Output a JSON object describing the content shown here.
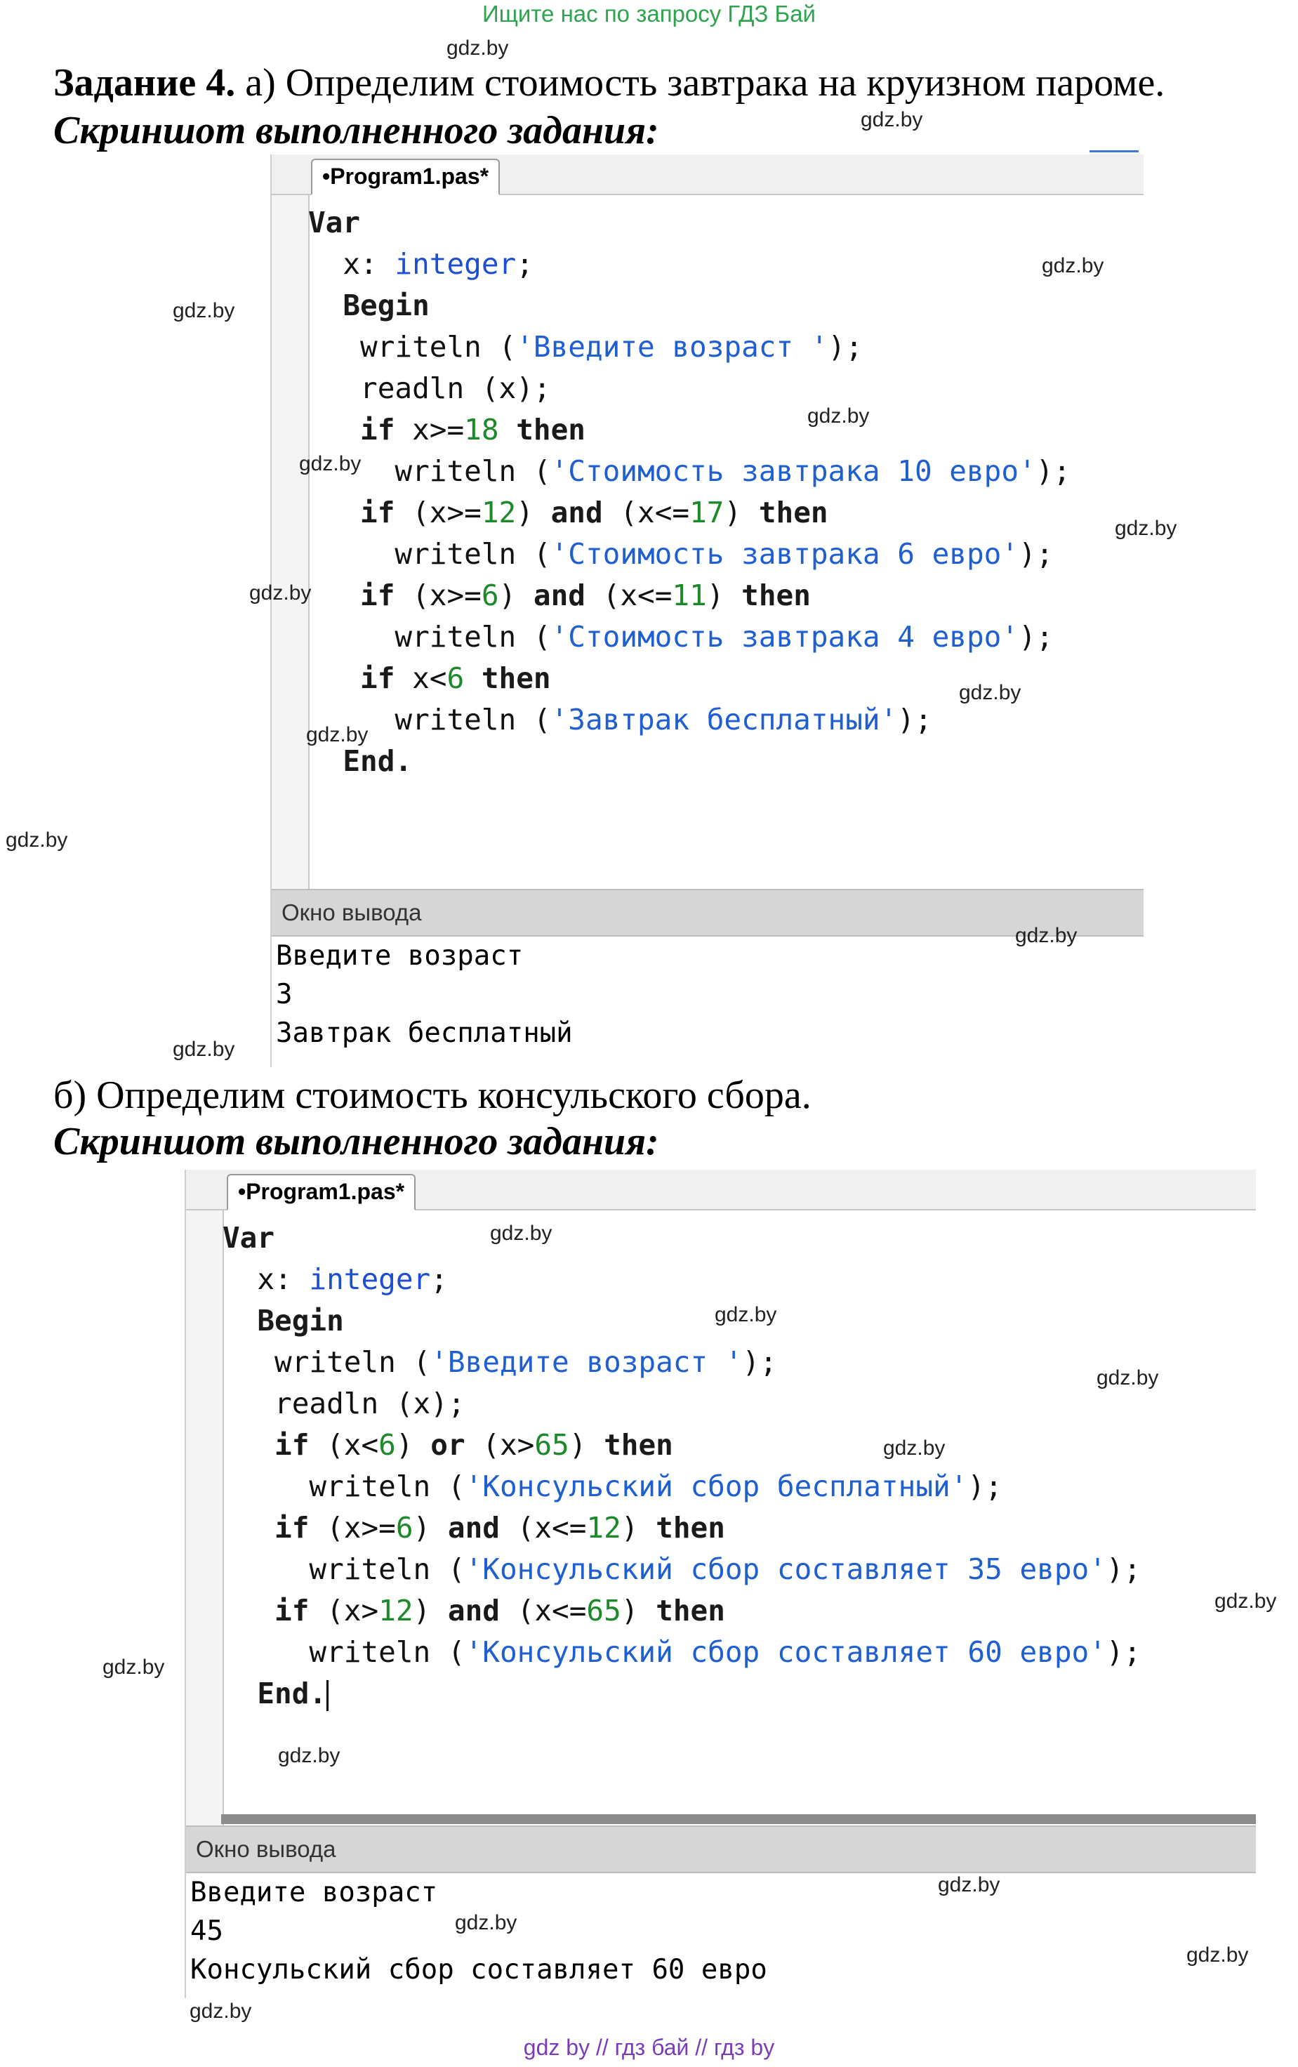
{
  "banner": "Ищите нас по запросу ГДЗ Бай",
  "task_a": {
    "title_bold": "Задание 4.",
    "title_rest": " а) Определим стоимость завтрака на круизном пароме.",
    "caption": "Скриншот выполненного задания:",
    "tab": "•Program1.pas*",
    "code": [
      [
        {
          "t": "Var",
          "c": "kw"
        }
      ],
      [
        {
          "t": "  x: ",
          "c": "id"
        },
        {
          "t": "integer",
          "c": "ty"
        },
        {
          "t": ";",
          "c": "id"
        }
      ],
      [
        {
          "t": "  Begin",
          "c": "kw"
        }
      ],
      [
        {
          "t": "   writeln (",
          "c": "id"
        },
        {
          "t": "'Введите возраст '",
          "c": "st"
        },
        {
          "t": ");",
          "c": "id"
        }
      ],
      [
        {
          "t": "   readln (x);",
          "c": "id"
        }
      ],
      [
        {
          "t": "   if",
          "c": "kw"
        },
        {
          "t": " x>=",
          "c": "id"
        },
        {
          "t": "18",
          "c": "nm"
        },
        {
          "t": " then",
          "c": "kw"
        }
      ],
      [
        {
          "t": "     writeln (",
          "c": "id"
        },
        {
          "t": "'Стоимость завтрака 10 евро'",
          "c": "st"
        },
        {
          "t": ");",
          "c": "id"
        }
      ],
      [
        {
          "t": "   if",
          "c": "kw"
        },
        {
          "t": " (x>=",
          "c": "id"
        },
        {
          "t": "12",
          "c": "nm"
        },
        {
          "t": ") ",
          "c": "id"
        },
        {
          "t": "and",
          "c": "kw"
        },
        {
          "t": " (x<=",
          "c": "id"
        },
        {
          "t": "17",
          "c": "nm"
        },
        {
          "t": ") ",
          "c": "id"
        },
        {
          "t": "then",
          "c": "kw"
        }
      ],
      [
        {
          "t": "     writeln (",
          "c": "id"
        },
        {
          "t": "'Стоимость завтрака 6 евро'",
          "c": "st"
        },
        {
          "t": ");",
          "c": "id"
        }
      ],
      [
        {
          "t": "   if",
          "c": "kw"
        },
        {
          "t": " (x>=",
          "c": "id"
        },
        {
          "t": "6",
          "c": "nm"
        },
        {
          "t": ") ",
          "c": "id"
        },
        {
          "t": "and",
          "c": "kw"
        },
        {
          "t": " (x<=",
          "c": "id"
        },
        {
          "t": "11",
          "c": "nm"
        },
        {
          "t": ") ",
          "c": "id"
        },
        {
          "t": "then",
          "c": "kw"
        }
      ],
      [
        {
          "t": "     writeln (",
          "c": "id"
        },
        {
          "t": "'Стоимость завтрака 4 евро'",
          "c": "st"
        },
        {
          "t": ");",
          "c": "id"
        }
      ],
      [
        {
          "t": "   if",
          "c": "kw"
        },
        {
          "t": " x<",
          "c": "id"
        },
        {
          "t": "6",
          "c": "nm"
        },
        {
          "t": " then",
          "c": "kw"
        }
      ],
      [
        {
          "t": "     writeln (",
          "c": "id"
        },
        {
          "t": "'Завтрак бесплатный'",
          "c": "st"
        },
        {
          "t": ");",
          "c": "id"
        }
      ],
      [
        {
          "t": "  End.",
          "c": "kw"
        }
      ]
    ],
    "output_header": "Окно вывода",
    "output": [
      "Введите возраст",
      "3",
      "Завтрак бесплатный"
    ]
  },
  "task_b": {
    "title": "б) Определим стоимость консульского сбора.",
    "caption": "Скриншот выполненного задания:",
    "tab": "•Program1.pas*",
    "code": [
      [
        {
          "t": "Var",
          "c": "kw"
        }
      ],
      [
        {
          "t": "  x: ",
          "c": "id"
        },
        {
          "t": "integer",
          "c": "ty"
        },
        {
          "t": ";",
          "c": "id"
        }
      ],
      [
        {
          "t": "  Begin",
          "c": "kw"
        }
      ],
      [
        {
          "t": "   writeln (",
          "c": "id"
        },
        {
          "t": "'Введите возраст '",
          "c": "st"
        },
        {
          "t": ");",
          "c": "id"
        }
      ],
      [
        {
          "t": "   readln (x);",
          "c": "id"
        }
      ],
      [
        {
          "t": "   if",
          "c": "kw"
        },
        {
          "t": " (x<",
          "c": "id"
        },
        {
          "t": "6",
          "c": "nm"
        },
        {
          "t": ") ",
          "c": "id"
        },
        {
          "t": "or",
          "c": "kw"
        },
        {
          "t": " (x>",
          "c": "id"
        },
        {
          "t": "65",
          "c": "nm"
        },
        {
          "t": ") ",
          "c": "id"
        },
        {
          "t": "then",
          "c": "kw"
        }
      ],
      [
        {
          "t": "     writeln (",
          "c": "id"
        },
        {
          "t": "'Консульский сбор бесплатный'",
          "c": "st"
        },
        {
          "t": ");",
          "c": "id"
        }
      ],
      [
        {
          "t": "   if",
          "c": "kw"
        },
        {
          "t": " (x>=",
          "c": "id"
        },
        {
          "t": "6",
          "c": "nm"
        },
        {
          "t": ") ",
          "c": "id"
        },
        {
          "t": "and",
          "c": "kw"
        },
        {
          "t": " (x<=",
          "c": "id"
        },
        {
          "t": "12",
          "c": "nm"
        },
        {
          "t": ") ",
          "c": "id"
        },
        {
          "t": "then",
          "c": "kw"
        }
      ],
      [
        {
          "t": "     writeln (",
          "c": "id"
        },
        {
          "t": "'Консульский сбор составляет 35 евро'",
          "c": "st"
        },
        {
          "t": ");",
          "c": "id"
        }
      ],
      [
        {
          "t": "   if",
          "c": "kw"
        },
        {
          "t": " (x>",
          "c": "id"
        },
        {
          "t": "12",
          "c": "nm"
        },
        {
          "t": ") ",
          "c": "id"
        },
        {
          "t": "and",
          "c": "kw"
        },
        {
          "t": " (x<=",
          "c": "id"
        },
        {
          "t": "65",
          "c": "nm"
        },
        {
          "t": ") ",
          "c": "id"
        },
        {
          "t": "then",
          "c": "kw"
        }
      ],
      [
        {
          "t": "     writeln (",
          "c": "id"
        },
        {
          "t": "'Консульский сбор составляет 60 евро'",
          "c": "st"
        },
        {
          "t": ");",
          "c": "id"
        }
      ],
      [
        {
          "t": "  End.",
          "c": "kw"
        }
      ]
    ],
    "output_header": "Окно вывода",
    "output": [
      "Введите возраст",
      "45",
      "Консульский сбор составляет 60 евро"
    ]
  },
  "watermark": "gdz.by",
  "footer": "gdz by  //  гдз бай  //  гдз by"
}
